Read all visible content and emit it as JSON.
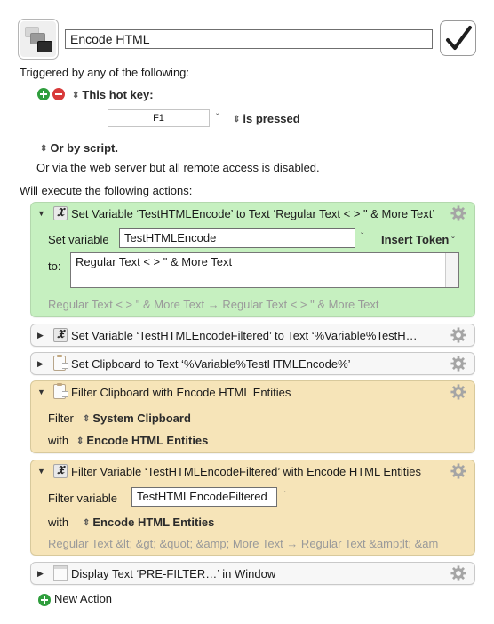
{
  "macro": {
    "icon": "macro-windows-icon",
    "name": "Encode HTML",
    "enabled_icon": "checkmark-icon",
    "enabled": true
  },
  "triggers": {
    "heading": "Triggered by any of the following:",
    "add_icon": "plus-circle-icon",
    "remove_icon": "minus-circle-icon",
    "hotkey_label": "This hot key:",
    "hotkey_value": "F1",
    "hotkey_condition": "is pressed",
    "script_label": "Or by script.",
    "web_server_note": "Or via the web server but all remote access is disabled."
  },
  "actions_heading": "Will execute the following actions:",
  "actions": [
    {
      "title": "Set Variable ‘TestHTMLEncode’ to Text ‘Regular Text < > \" & More Text’",
      "icon": "variable-x-icon",
      "expanded": true,
      "color": "#c6f0c0",
      "set_variable_label": "Set variable",
      "variable_value": "TestHTMLEncode",
      "insert_token_label": "Insert Token",
      "to_label": "to:",
      "text_value": "Regular Text < > \" & More Text",
      "preview": "Regular Text < > \" & More Text → Regular Text < > \" & More Text"
    },
    {
      "title": "Set Variable ‘TestHTMLEncodeFiltered’ to Text ‘%Variable%TestH…",
      "icon": "variable-x-icon",
      "expanded": false
    },
    {
      "title": "Set Clipboard to Text ‘%Variable%TestHTMLEncode%’",
      "icon": "clipboard-icon",
      "expanded": false
    },
    {
      "title": "Filter Clipboard with Encode HTML Entities",
      "icon": "clipboard-icon",
      "expanded": true,
      "color": "#f6e4b8",
      "filter_label": "Filter",
      "filter_value": "System Clipboard",
      "with_label": "with",
      "with_value": "Encode HTML Entities"
    },
    {
      "title": "Filter Variable ‘TestHTMLEncodeFiltered’ with Encode HTML Entities",
      "icon": "variable-x-icon",
      "expanded": true,
      "color": "#f6e4b8",
      "filter_variable_label": "Filter variable",
      "variable_value": "TestHTMLEncodeFiltered",
      "with_label": "with",
      "with_value": "Encode HTML Entities",
      "preview": "Regular Text &lt; &gt; &quot; &amp; More Text → Regular Text &amp;lt; &am"
    },
    {
      "title": "Display Text ‘PRE-FILTER…’ in Window",
      "icon": "window-icon",
      "expanded": false
    }
  ],
  "new_action_label": "New Action",
  "glyphs": {
    "updown": "⇕",
    "chevron": "˅",
    "tri_down": "▼",
    "tri_right": "▶",
    "x": "𝒳"
  }
}
